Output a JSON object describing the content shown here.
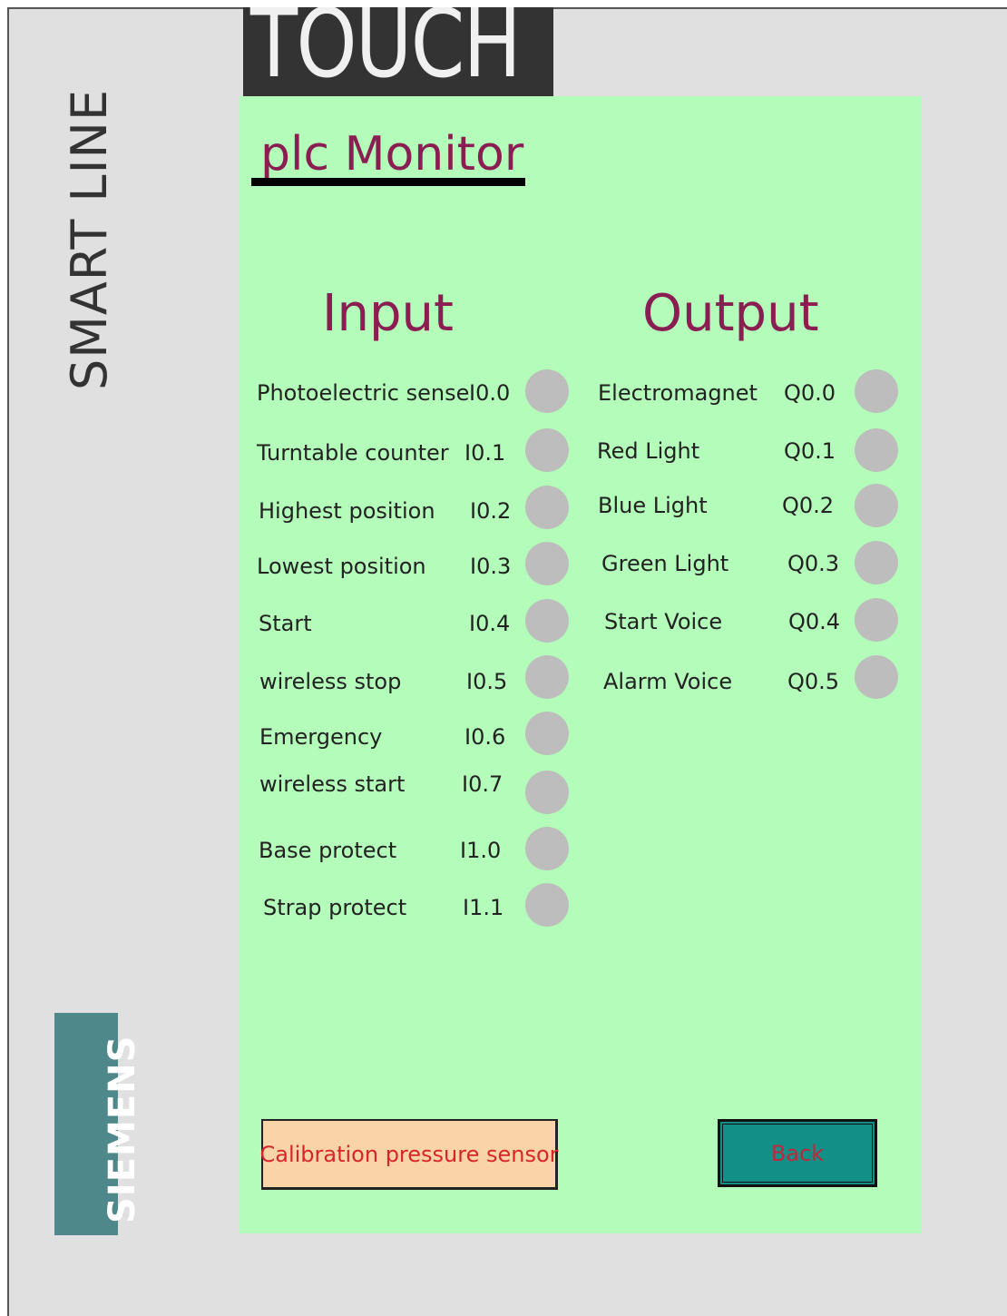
{
  "header": {
    "brand_touch": "TOUCH",
    "side_label": "SMART LINE",
    "logo": "SIEMENS"
  },
  "screen": {
    "title": "plc Monitor",
    "input_heading": "Input",
    "output_heading": "Output"
  },
  "inputs": [
    {
      "label": "Photoelectric sense",
      "address": "I0.0",
      "state": "off"
    },
    {
      "label": "Turntable counter",
      "address": "I0.1",
      "state": "off"
    },
    {
      "label": "Highest position",
      "address": "I0.2",
      "state": "off"
    },
    {
      "label": "Lowest position",
      "address": "I0.3",
      "state": "off"
    },
    {
      "label": "Start",
      "address": "I0.4",
      "state": "off"
    },
    {
      "label": "wireless stop",
      "address": "I0.5",
      "state": "off"
    },
    {
      "label": "Emergency",
      "address": "I0.6",
      "state": "off"
    },
    {
      "label": "wireless start",
      "address": "I0.7",
      "state": "off"
    },
    {
      "label": "Base protect",
      "address": "I1.0",
      "state": "off"
    },
    {
      "label": "Strap protect",
      "address": "I1.1",
      "state": "off"
    }
  ],
  "outputs": [
    {
      "label": "Electromagnet",
      "address": "Q0.0",
      "state": "off"
    },
    {
      "label": "Red Light",
      "address": "Q0.1",
      "state": "off"
    },
    {
      "label": "Blue Light",
      "address": "Q0.2",
      "state": "off"
    },
    {
      "label": "Green Light",
      "address": "Q0.3",
      "state": "off"
    },
    {
      "label": "Start Voice",
      "address": "Q0.4",
      "state": "off"
    },
    {
      "label": "Alarm Voice",
      "address": "Q0.5",
      "state": "off"
    }
  ],
  "buttons": {
    "calibration": "Calibration  pressure sensor",
    "back": "Back"
  },
  "colors": {
    "panel_bg": "#b3fcb9",
    "heading": "#8a1d52",
    "lamp_off": "#bdbdbd",
    "calibration_bg": "#f9d4a8",
    "back_bg": "#128f86",
    "button_text": "#d8242b",
    "siemens_bg": "#4e888a"
  }
}
